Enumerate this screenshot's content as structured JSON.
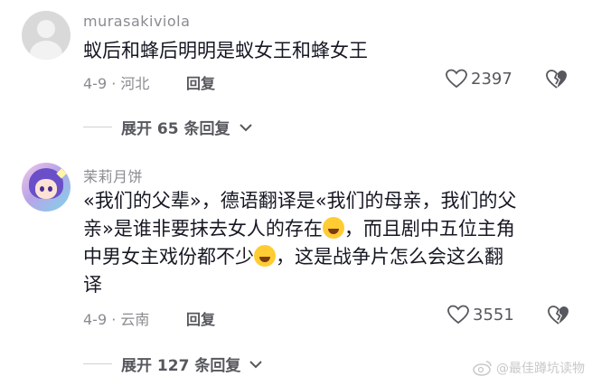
{
  "comments": [
    {
      "username": "murasakiviola",
      "text_lines": [
        "蚁后和蜂后明明是蚁女王和蜂女王"
      ],
      "date_location": "4-9 · 河北",
      "reply_label": "回复",
      "like_count": "2397",
      "avatar_icon": "default-avatar-icon",
      "expand_label": "展开 65 条回复"
    },
    {
      "username": "茉莉月饼",
      "text_lines": [
        "«我们的父辈»，德语翻译是«我们的母亲，我们的父",
        "亲»是谁非要抹去女人的存在",
        "中男女主戏份都不少",
        "译"
      ],
      "text_line2_suffix": "，而且剧中五位主角",
      "text_line3_suffix": "，这是战争片怎么会这么翻",
      "date_location": "4-9 · 云南",
      "reply_label": "回复",
      "like_count": "3551",
      "avatar_icon": "anime-avatar-icon",
      "expand_label": "展开 127 条回复"
    }
  ],
  "watermark": "@最佳蹲坑读物",
  "colors": {
    "text": "#161823",
    "muted": "#8a8b91",
    "action": "#57585e"
  }
}
